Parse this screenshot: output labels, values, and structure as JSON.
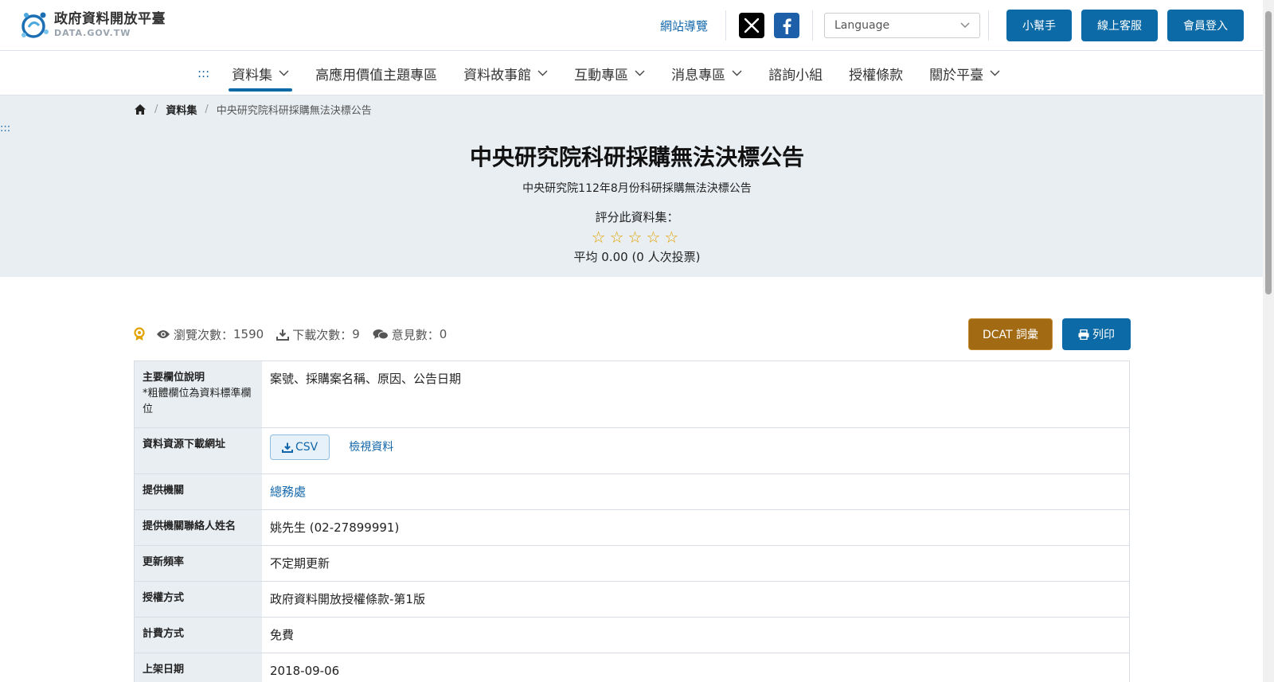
{
  "header": {
    "logo_title": "政府資料開放平臺",
    "logo_sub": "DATA.GOV.TW",
    "sitemap": "網站導覽",
    "language_placeholder": "Language",
    "buttons": [
      "小幫手",
      "線上客服",
      "會員登入"
    ]
  },
  "nav": {
    "dots": ":::",
    "items": [
      {
        "label": "資料集",
        "dropdown": true,
        "active": true
      },
      {
        "label": "高應用價值主題專區",
        "dropdown": false
      },
      {
        "label": "資料故事館",
        "dropdown": true
      },
      {
        "label": "互動專區",
        "dropdown": true
      },
      {
        "label": "消息專區",
        "dropdown": true
      },
      {
        "label": "諮詢小組",
        "dropdown": false
      },
      {
        "label": "授權條款",
        "dropdown": false
      },
      {
        "label": "關於平臺",
        "dropdown": true
      }
    ]
  },
  "breadcrumb": {
    "sep": "/",
    "section": "資料集",
    "current": "中央研究院科研採購無法決標公告"
  },
  "skip_dots": ":::",
  "dataset": {
    "title": "中央研究院科研採購無法決標公告",
    "description": "中央研究院112年8月份科研採購無法決標公告",
    "rate_label": "評分此資料集：",
    "stars": "☆☆☆☆☆",
    "average": "平均 0.00 (0 人次投票)"
  },
  "stats": {
    "views_label": "瀏覽次數：",
    "views": "1590",
    "downloads_label": "下載次數：",
    "downloads": "9",
    "comments_label": "意見數：",
    "comments": "0",
    "dcat": "DCAT 詞彙",
    "print": "列印"
  },
  "meta": {
    "fields_label": "主要欄位說明",
    "fields_note": "*粗體欄位為資料標準欄位",
    "fields_value": "案號、採購案名稱、原因、公告日期",
    "download_label": "資料資源下載網址",
    "csv": "CSV",
    "view_data": "檢視資料",
    "agency_label": "提供機關",
    "agency_value": "總務處",
    "contact_label": "提供機關聯絡人姓名",
    "contact_value": "姚先生 (02-27899991)",
    "frequency_label": "更新頻率",
    "frequency_value": "不定期更新",
    "license_label": "授權方式",
    "license_value": "政府資料開放授權條款-第1版",
    "fee_label": "計費方式",
    "fee_value": "免費",
    "date_label": "上架日期",
    "date_value": "2018-09-06"
  },
  "colors": {
    "primary": "#0c6aa6",
    "dcat": "#a36a14",
    "hero_bg": "#e9eef2",
    "star": "#e2a300"
  }
}
